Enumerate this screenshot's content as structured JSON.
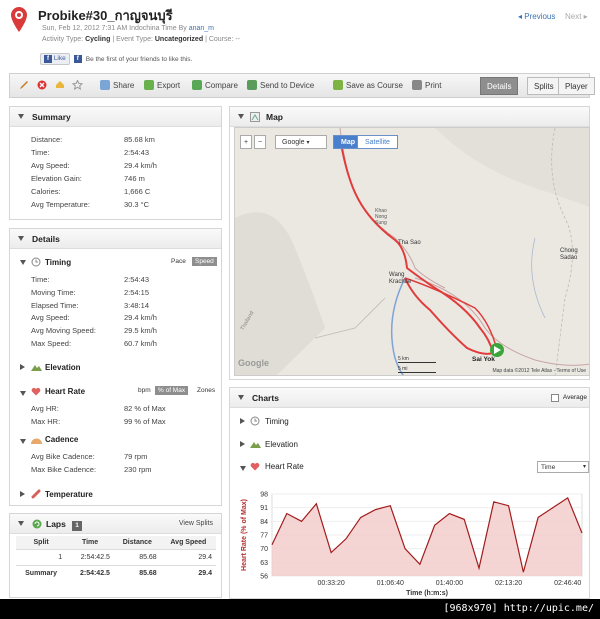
{
  "header": {
    "title": "Probike#30_กาญจนบุรี",
    "date_line": "Sun, Feb 12, 2012 7:31 AM Indochina Time By",
    "author": "anan_m",
    "activity_label": "Activity Type:",
    "activity": "Cycling",
    "event_label": "| Event Type:",
    "event": "Uncategorized",
    "course": "| Course: --",
    "like": "Like",
    "like_text": "Be the first of your friends to like this.",
    "prev": "Previous",
    "next": "Next"
  },
  "toolbar": {
    "share": "Share",
    "export": "Export",
    "compare": "Compare",
    "send": "Send to Device",
    "save": "Save as Course",
    "print": "Print",
    "tabs": [
      "Details",
      "Splits",
      "Player"
    ]
  },
  "summary": {
    "title": "Summary",
    "rows": [
      [
        "Distance:",
        "85.68 km"
      ],
      [
        "Time:",
        "2:54:43"
      ],
      [
        "Avg Speed:",
        "29.4 km/h"
      ],
      [
        "Elevation Gain:",
        "746 m"
      ],
      [
        "Calories:",
        "1,666 C"
      ],
      [
        "Avg Temperature:",
        "30.3 °C"
      ]
    ]
  },
  "details": {
    "title": "Details",
    "timing": {
      "title": "Timing",
      "pace": "Pace",
      "speed": "Speed",
      "rows": [
        [
          "Time:",
          "2:54:43"
        ],
        [
          "Moving Time:",
          "2:54:15"
        ],
        [
          "Elapsed Time:",
          "3:48:14"
        ],
        [
          "Avg Speed:",
          "29.4 km/h"
        ],
        [
          "Avg Moving Speed:",
          "29.5 km/h"
        ],
        [
          "Max Speed:",
          "60.7 km/h"
        ]
      ]
    },
    "elevation": "Elevation",
    "heartrate": {
      "title": "Heart Rate",
      "bpm": "bpm",
      "pct": "% of Max",
      "zones": "Zones",
      "rows": [
        [
          "Avg HR:",
          "82 % of Max"
        ],
        [
          "Max HR:",
          "99 % of Max"
        ]
      ]
    },
    "cadence": {
      "title": "Cadence",
      "rows": [
        [
          "Avg Bike Cadence:",
          "79 rpm"
        ],
        [
          "Max Bike Cadence:",
          "230 rpm"
        ]
      ]
    },
    "temperature": "Temperature"
  },
  "laps": {
    "title": "Laps",
    "count": "1",
    "view": "View Splits",
    "headers": [
      "Split",
      "Time",
      "Distance",
      "Avg Speed"
    ],
    "rows": [
      [
        "1",
        "2:54:42.5",
        "85.68",
        "29.4"
      ],
      [
        "Summary",
        "2:54:42.5",
        "85.68",
        "29.4"
      ]
    ]
  },
  "map": {
    "title": "Map",
    "plus": "+",
    "minus": "−",
    "provider": "Google",
    "map_btn": "Map",
    "sat_btn": "Satellite",
    "places": [
      "Khao Nong Sung",
      "Tha Sao",
      "Wang Krachae",
      "Chong Sadao",
      "Sai Yok",
      "Thailand"
    ],
    "scale_km": "5 km",
    "scale_mi": "5 mi",
    "copyright": "Map data ©2012 Tele Atlas - Terms of Use",
    "google": "Google"
  },
  "charts": {
    "title": "Charts",
    "average": "Average",
    "timing": "Timing",
    "elevation": "Elevation",
    "heartrate": "Heart Rate",
    "select": "Time"
  },
  "chart_data": {
    "type": "line",
    "title": "",
    "xlabel": "Time (h:m:s)",
    "ylabel": "Heart Rate (% of Max)",
    "yticks": [
      56,
      63,
      70,
      77,
      84,
      91,
      98
    ],
    "ylim": [
      56,
      98
    ],
    "xticks": [
      "00:33:20",
      "01:06:40",
      "01:40:00",
      "02:13:20",
      "02:46:40"
    ],
    "x_seconds": [
      0,
      500,
      1000,
      1500,
      2000,
      2500,
      3000,
      3500,
      4000,
      4500,
      5000,
      5500,
      6000,
      6500,
      7000,
      7500,
      8000,
      8500,
      9000,
      9500,
      10000,
      10483
    ],
    "series": [
      {
        "values": [
          72,
          88,
          84,
          93,
          68,
          75,
          86,
          90,
          92,
          70,
          62,
          82,
          88,
          85,
          60,
          94,
          92,
          58,
          86,
          91,
          96,
          78
        ]
      }
    ]
  }
}
